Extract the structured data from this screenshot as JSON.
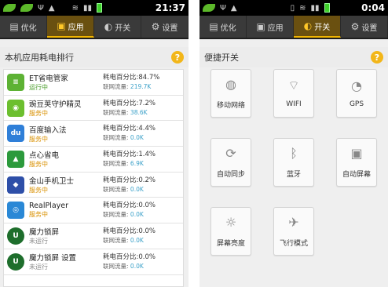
{
  "left": {
    "status": {
      "time": "21:37"
    },
    "tabs": [
      {
        "label": "优化",
        "icon": "optimize-icon"
      },
      {
        "label": "应用",
        "icon": "apps-icon",
        "active": true
      },
      {
        "label": "开关",
        "icon": "switch-icon"
      },
      {
        "label": "设置",
        "icon": "settings-icon"
      }
    ],
    "section_title": "本机应用耗电排行",
    "help": "?",
    "apps": [
      {
        "name": "ET省电管家",
        "status": "运行中",
        "power_label": "耗电百分比:",
        "power": "84.7%",
        "net_label": "联网流量:",
        "net": "219.7K",
        "icon_color": "#5db234",
        "icon_char": "≡"
      },
      {
        "name": "豌豆荚守护精灵",
        "status": "服务中",
        "power_label": "耗电百分比:",
        "power": "7.2%",
        "net_label": "联网流量:",
        "net": "38.6K",
        "icon_color": "#6cbf2f",
        "icon_char": "◉"
      },
      {
        "name": "百度输入法",
        "status": "服务中",
        "power_label": "耗电百分比:",
        "power": "4.4%",
        "net_label": "联网流量:",
        "net": "0.0K",
        "icon_color": "#2f7fd8",
        "icon_char": "du"
      },
      {
        "name": "点心省电",
        "status": "服务中",
        "power_label": "耗电百分比:",
        "power": "1.4%",
        "net_label": "联网流量:",
        "net": "6.9K",
        "icon_color": "#2c9a3c",
        "icon_char": "▲"
      },
      {
        "name": "金山手机卫士",
        "status": "服务中",
        "power_label": "耗电百分比:",
        "power": "0.2%",
        "net_label": "联网流量:",
        "net": "0.0K",
        "icon_color": "#2e4fa8",
        "icon_char": "◆"
      },
      {
        "name": "RealPlayer",
        "status": "服务中",
        "power_label": "耗电百分比:",
        "power": "0.0%",
        "net_label": "联网流量:",
        "net": "0.0K",
        "icon_color": "#2a88d6",
        "icon_char": "◎"
      },
      {
        "name": "魔力锁屏",
        "status": "未运行",
        "power_label": "耗电百分比:",
        "power": "0.0%",
        "net_label": "联网流量:",
        "net": "0.0K",
        "icon_color": "#1e6e2c",
        "icon_char": "U"
      },
      {
        "name": "魔力锁屏 设置",
        "status": "未运行",
        "power_label": "耗电百分比:",
        "power": "0.0%",
        "net_label": "联网流量:",
        "net": "0.0K",
        "icon_color": "#1e6e2c",
        "icon_char": "U"
      }
    ]
  },
  "right": {
    "status": {
      "time": "0:04"
    },
    "tabs": [
      {
        "label": "优化",
        "icon": "optimize-icon"
      },
      {
        "label": "应用",
        "icon": "apps-icon"
      },
      {
        "label": "开关",
        "icon": "switch-icon",
        "active": true
      },
      {
        "label": "设置",
        "icon": "settings-icon"
      }
    ],
    "section_title": "便捷开关",
    "help": "?",
    "toggles": [
      {
        "label": "移动网络",
        "icon": "globe-icon",
        "glyph": "◍"
      },
      {
        "label": "WIFI",
        "icon": "wifi-icon",
        "glyph": "⌔"
      },
      {
        "label": "GPS",
        "icon": "gps-icon",
        "glyph": "◔"
      },
      {
        "label": "自动同步",
        "icon": "sync-icon",
        "glyph": "⟳"
      },
      {
        "label": "蓝牙",
        "icon": "bluetooth-icon",
        "glyph": "ᛒ"
      },
      {
        "label": "自动屏幕",
        "icon": "screen-rotate-icon",
        "glyph": "▣"
      },
      {
        "label": "屏幕亮度",
        "icon": "brightness-icon",
        "glyph": "☼"
      },
      {
        "label": "飞行模式",
        "icon": "airplane-icon",
        "glyph": "✈"
      }
    ]
  }
}
